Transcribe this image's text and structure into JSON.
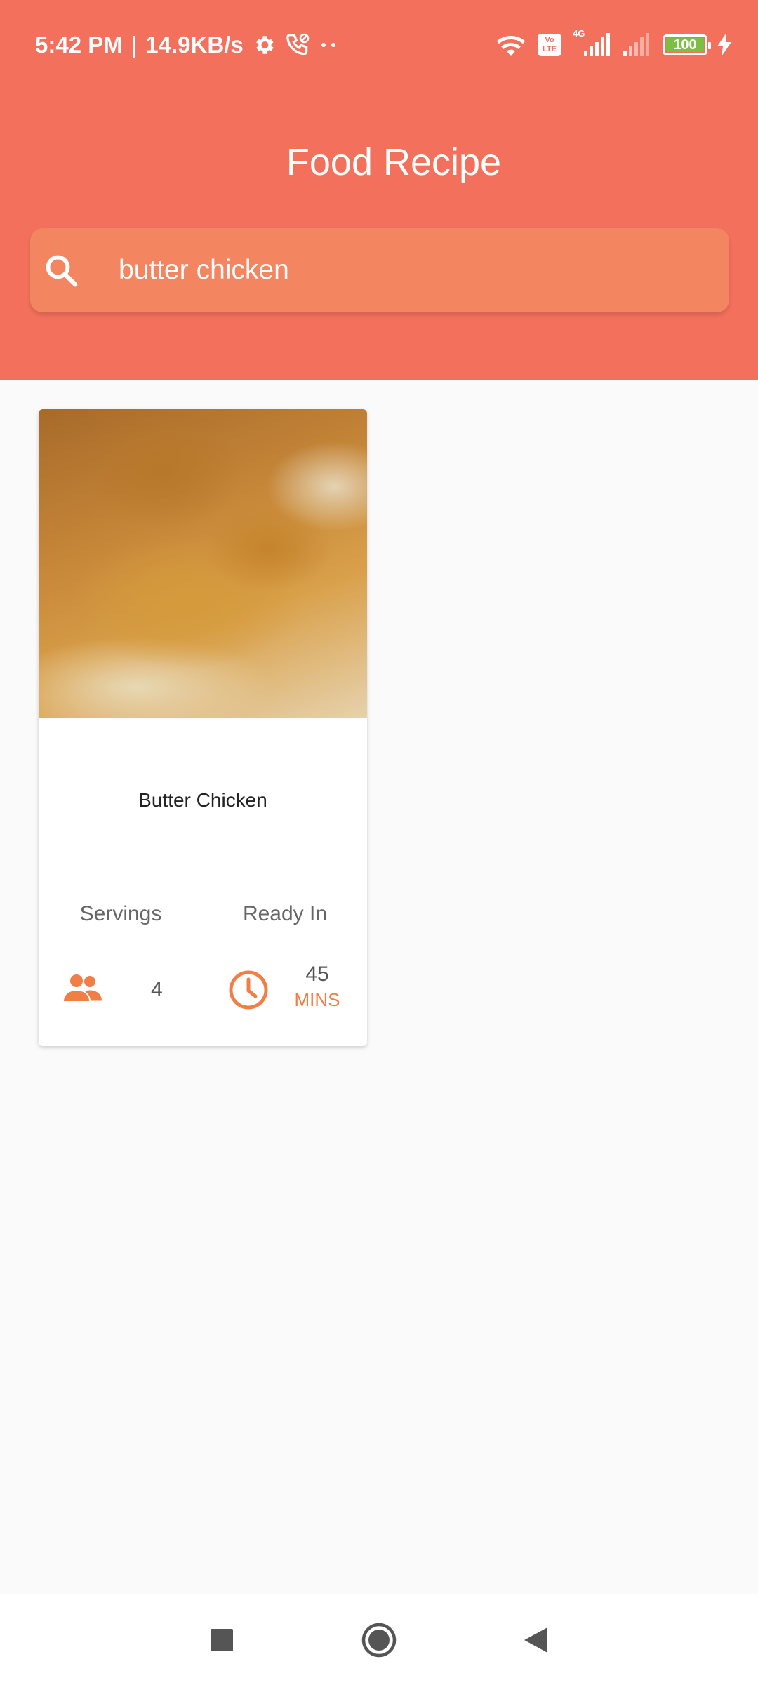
{
  "status_bar": {
    "time": "5:42 PM",
    "separator": "|",
    "speed": "14.9KB/s",
    "network_label": "4G",
    "volte_label": "Vo LTE",
    "battery": "100",
    "icons": [
      "gear-icon",
      "call-icon",
      "dots-icon",
      "wifi-icon",
      "volte-icon",
      "signal-icon",
      "signal-weak-icon",
      "battery-icon",
      "charging-icon"
    ]
  },
  "header": {
    "title": "Food Recipe",
    "background_color": "#f2705c"
  },
  "search": {
    "value": "butter chicken",
    "icon": "search-icon"
  },
  "results": [
    {
      "title": "Butter Chicken",
      "servings_label": "Servings",
      "servings_value": "4",
      "ready_label": "Ready In",
      "ready_value": "45",
      "ready_unit": "MINS",
      "accent_color": "#f07e45"
    }
  ],
  "nav": {
    "icons": [
      "square-icon",
      "circle-icon",
      "back-triangle-icon"
    ]
  }
}
